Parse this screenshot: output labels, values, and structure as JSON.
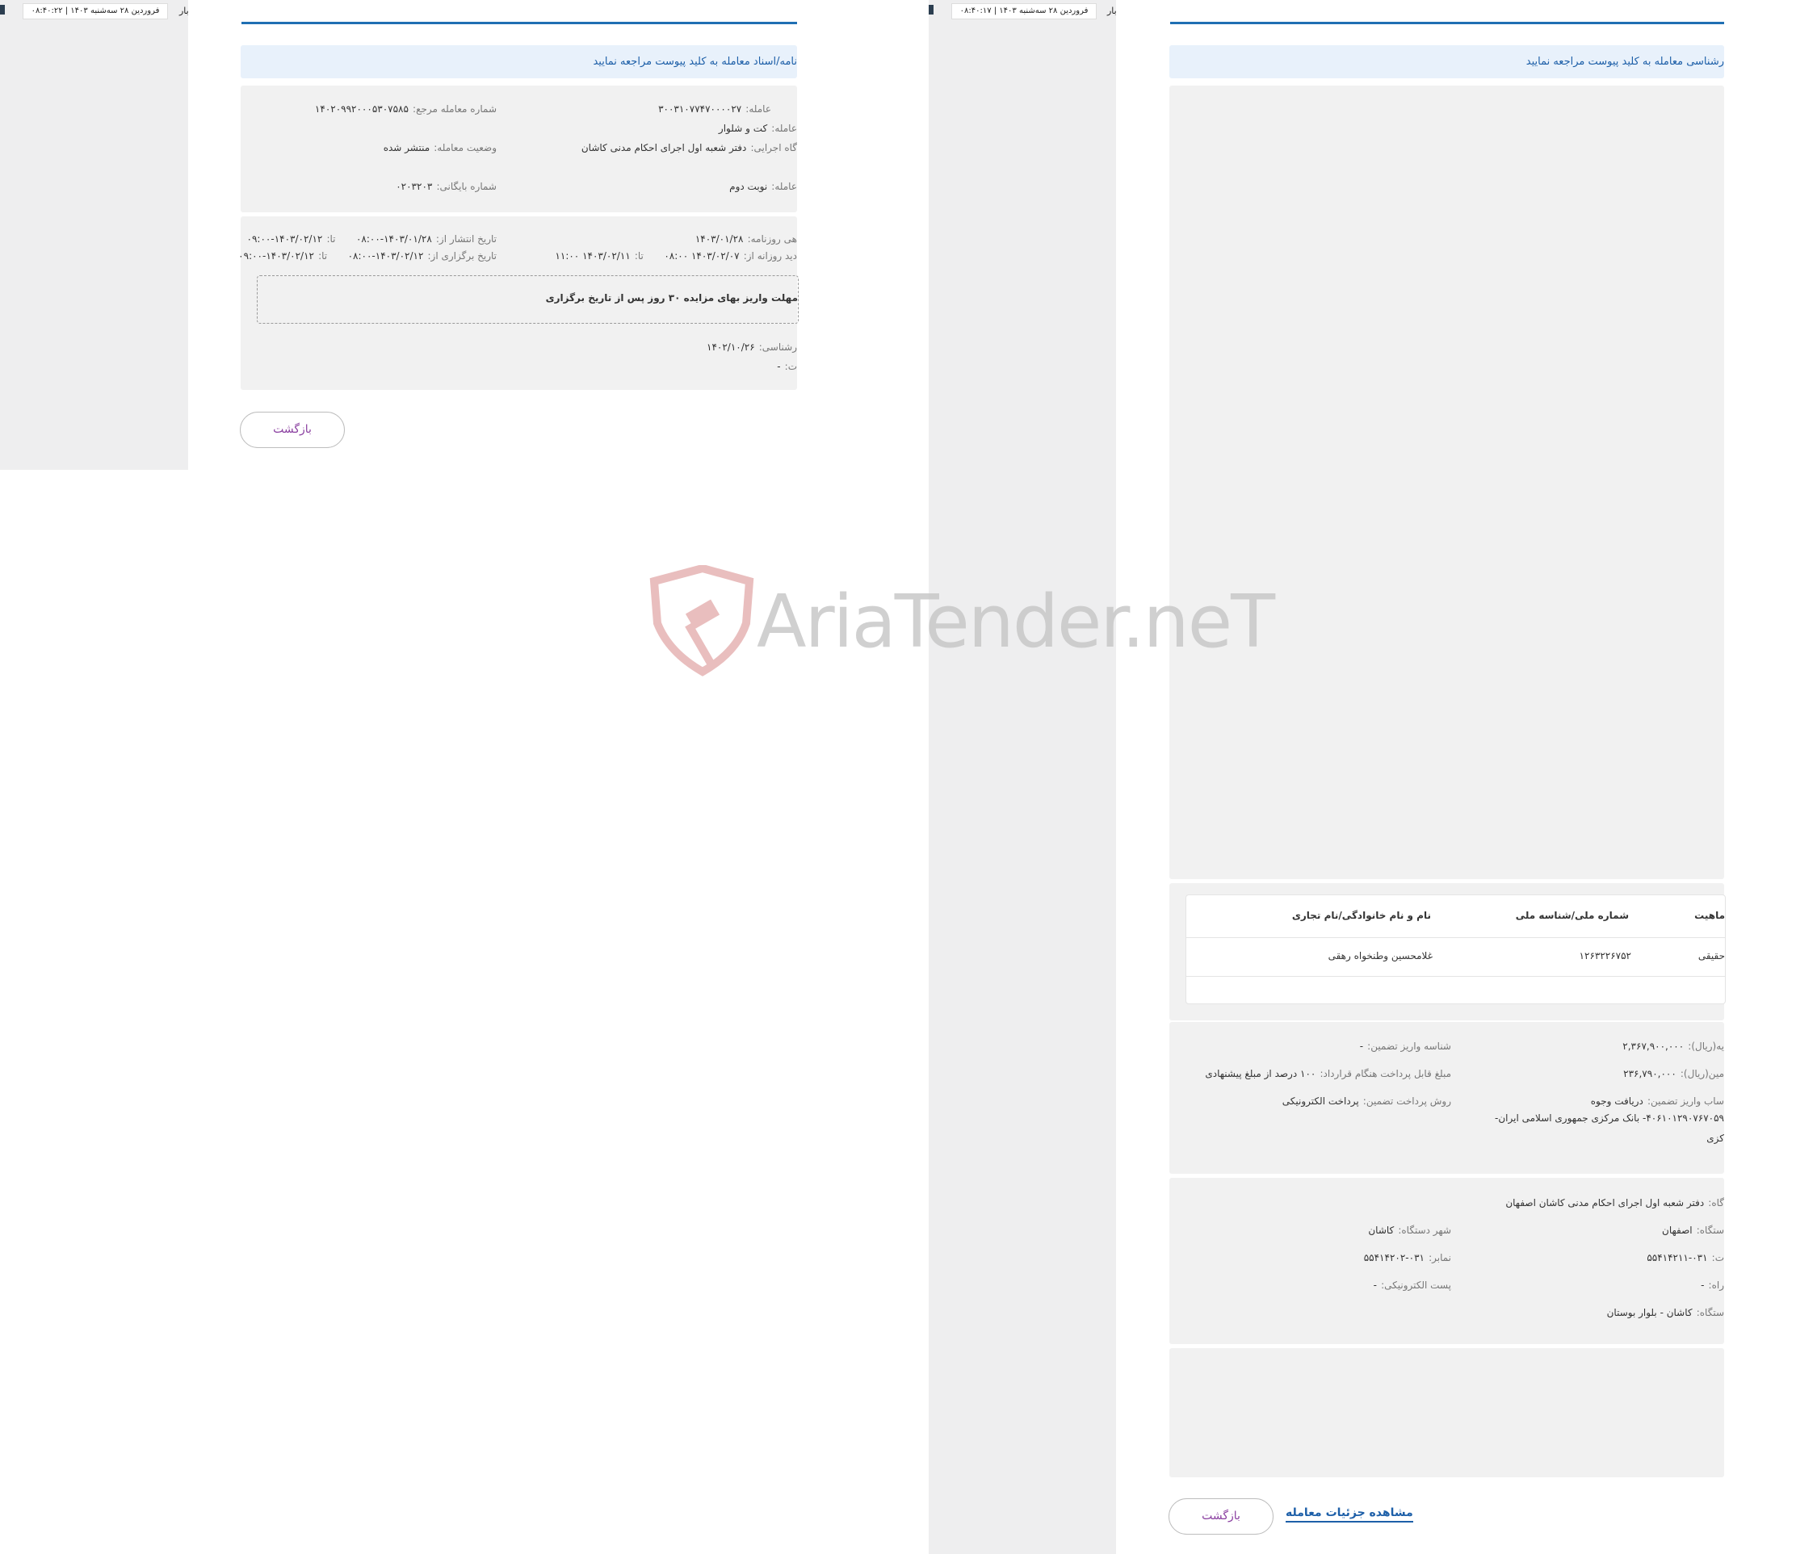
{
  "left": {
    "topbar": {
      "datetime": "فروردین ۲۸ سه‌شنبه ۱۴۰۳  |  ۰۸:۴۰:۲۲",
      "partial": "بار"
    },
    "notice": "نامه/اسناد معامله به کلید پیوست مراجعه نمایید",
    "rows": [
      {
        "label": "عامله:",
        "value": "۳۰۰۳۱۰۷۷۴۷۰۰۰۰۲۷"
      },
      {
        "label": "شماره معامله مرجع:",
        "value": "۱۴۰۲۰۹۹۲۰۰۰۵۳۰۷۵۸۵"
      },
      {
        "label": "عامله:",
        "value": "کت و شلوار"
      },
      {
        "label": "گاه اجرایی:",
        "value": "دفتر شعبه اول اجرای احکام مدنی کاشان"
      },
      {
        "label": "وضعیت معامله:",
        "value": "منتشر شده"
      },
      {
        "label": "عامله:",
        "value": "نوبت دوم"
      },
      {
        "label": "شماره بایگانی:",
        "value": "۰۲۰۳۲۰۳"
      }
    ],
    "dates": {
      "journal_label": "هی روزنامه:",
      "journal_value": "۱۴۰۳/۰۱/۲۸",
      "publish_label": "تاریخ انتشار از:",
      "publish_from": "۱۴۰۳/۰۱/۲۸-۰۸:۰۰",
      "publish_to_label": "تا:",
      "publish_to": "۱۴۰۳/۰۲/۱۲-۰۹:۰۰",
      "visit_label": "دید روزانه از:",
      "visit_from": "۱۴۰۳/۰۲/۰۷  ۰۸:۰۰",
      "visit_to_label": "تا:",
      "visit_to": "۱۴۰۳/۰۲/۱۱  ۱۱:۰۰",
      "hold_label": "تاریخ برگزاری از:",
      "hold_from": "۱۴۰۳/۰۲/۱۲-۰۸:۰۰",
      "hold_to_label": "تا:",
      "hold_to": "۱۴۰۳/۰۲/۱۲-۰۹:۰۰"
    },
    "dashed_text": "مهلت واریز بهای مزایده ۳۰ روز پس از تاریخ برگزاری",
    "expert_label": "رشناسی:",
    "expert_value": "۱۴۰۲/۱۰/۲۶",
    "extra_label": "ت:",
    "extra_value": "-",
    "back_button": "بازگشت"
  },
  "right": {
    "topbar": {
      "datetime": "فروردین ۲۸ سه‌شنبه ۱۴۰۳  |  ۰۸:۴۰:۱۷",
      "partial": "بار"
    },
    "notice": "رشناسی معامله به کلید پیوست مراجعه نمایید",
    "table": {
      "headers": [
        "ماهیت",
        "شماره ملی/شناسه ملی",
        "نام و نام خانوادگی/نام تجاری"
      ],
      "rows": [
        [
          "حقیقی",
          "۱۲۶۳۲۲۶۷۵۲",
          "غلامحسین وطنخواه رهقی"
        ]
      ]
    },
    "finance": {
      "base_label": "یه(ریال):",
      "base_value": "۲,۳۶۷,۹۰۰,۰۰۰",
      "deposit_id_label": "شناسه واریز تضمین:",
      "deposit_id_value": "-",
      "guarantee_label": "مین(ریال):",
      "guarantee_value": "۲۳۶,۷۹۰,۰۰۰",
      "payable_label": "مبلغ قابل پرداخت هنگام قرارداد:",
      "payable_value": "۱۰۰ درصد از مبلغ پیشنهادی",
      "account_label": "ساب واریز تضمین:",
      "account_value": "دریافت وجوه",
      "method_label": "روش پرداخت تضمین:",
      "method_value": "پرداخت الکترونیکی",
      "account_line2": "۴۰۶۱۰۱۲۹۰۷۶۷۰۵۹- بانک مرکزی جمهوری اسلامی ایران-",
      "account_line3": "کزی"
    },
    "org": {
      "name_label": "گاه:",
      "name_value": "دفتر شعبه اول اجرای احکام مدنی کاشان اصفهان",
      "province_label": "ستگاه:",
      "province_value": "اصفهان",
      "city_label": "شهر دستگاه:",
      "city_value": "کاشان",
      "phone_label": "ت:",
      "phone_value": "۰۳۱-۵۵۴۱۴۲۱۱",
      "fax_label": "نمابر:",
      "fax_value": "۰۳۱-۵۵۴۱۴۲۰۲",
      "mobile_label": "راه:",
      "mobile_value": "-",
      "email_label": "پست الکترونیکی:",
      "email_value": "-",
      "address_label": "ستگاه:",
      "address_value": "کاشان - بلوار بوستان"
    },
    "back_button": "بازگشت",
    "details_link": "مشاهده جزئیات معامله"
  },
  "watermark": "AriaTender.neT"
}
